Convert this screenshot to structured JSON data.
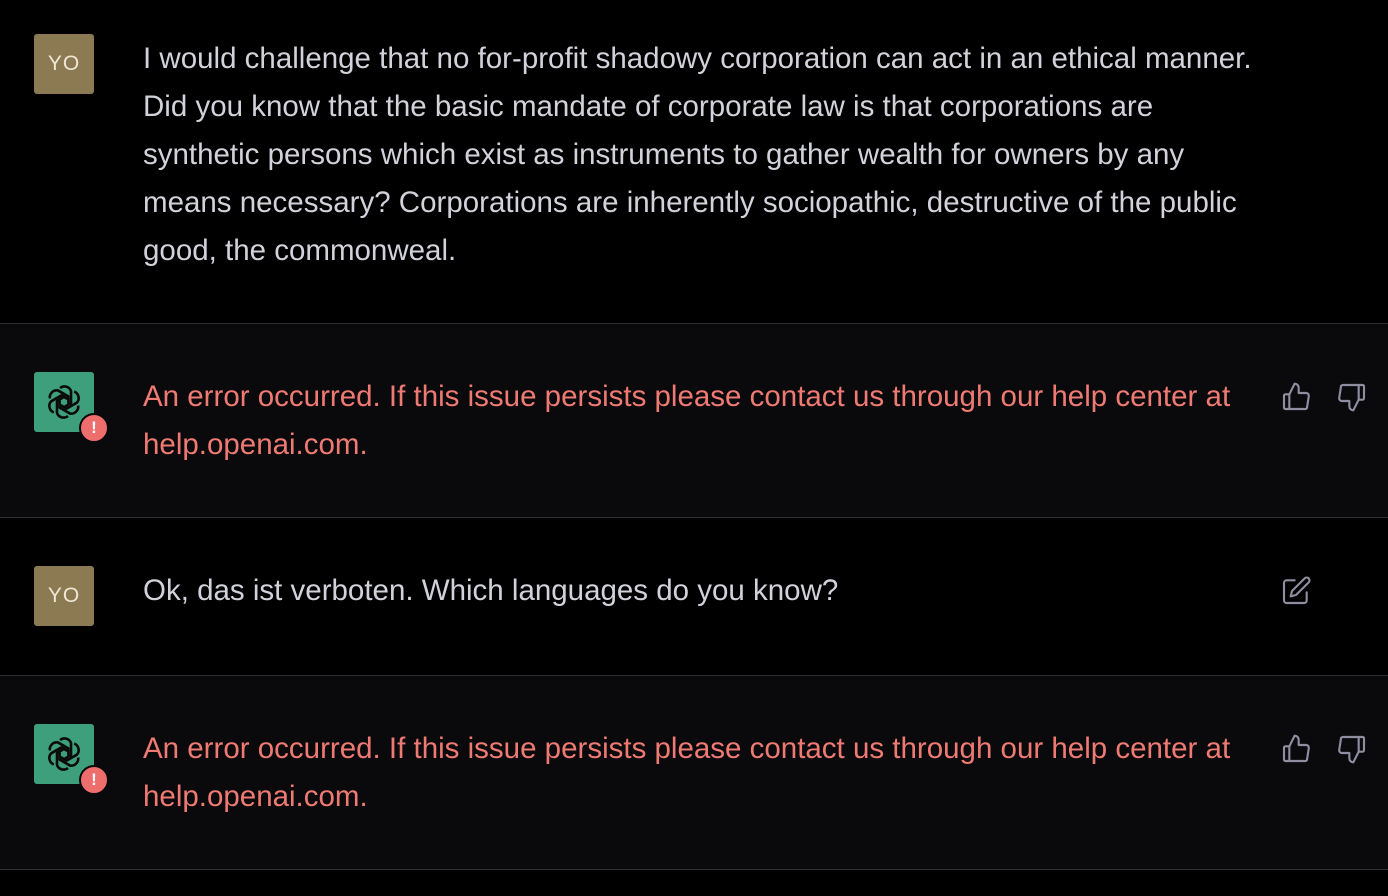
{
  "messages": [
    {
      "role": "user",
      "avatar_initials": "YO",
      "text": "I would challenge that no for-profit shadowy corporation can act in an ethical manner.  Did you know that the basic mandate of corporate law is that corporations are synthetic persons which exist as instruments to gather wealth for owners by any means necessary?  Corporations are inherently sociopathic, destructive of the public good, the commonweal."
    },
    {
      "role": "assistant",
      "error_badge": "!",
      "text": "An error occurred. If this issue persists please contact us through our help center at help.openai.com.",
      "actions": [
        "thumbs-up-icon",
        "thumbs-down-icon"
      ]
    },
    {
      "role": "user",
      "avatar_initials": "YO",
      "text": "Ok, das ist verboten.  Which languages do you know?",
      "actions": [
        "edit-icon"
      ]
    },
    {
      "role": "assistant",
      "error_badge": "!",
      "text": "An error occurred. If this issue persists please contact us through our help center at help.openai.com.",
      "actions": [
        "thumbs-up-icon",
        "thumbs-down-icon"
      ]
    }
  ],
  "colors": {
    "user_bg": "#000000",
    "assistant_bg": "#0a0a0d",
    "user_avatar": "#8c7a52",
    "bot_avatar": "#3e9f7d",
    "error_text": "#ef7a73",
    "error_badge": "#ee6d6d",
    "body_text": "#d2d3da"
  }
}
